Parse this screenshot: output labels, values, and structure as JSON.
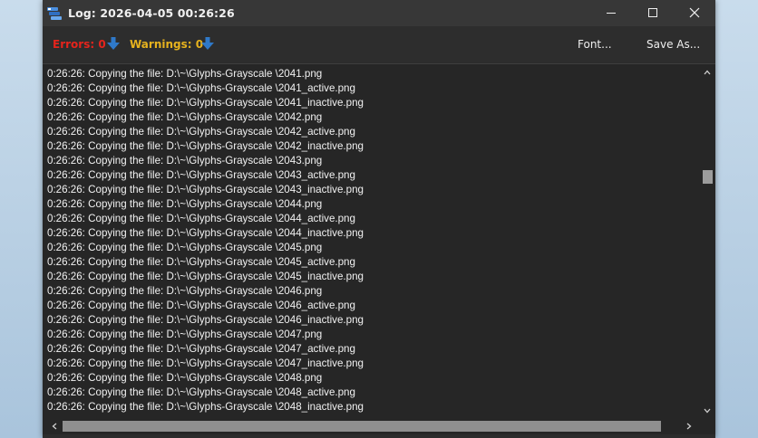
{
  "window": {
    "title": "Log: 2026-04-05 00:26:26",
    "icon": "log-app-icon",
    "controls": [
      "minimize-icon",
      "maximize-icon",
      "close-icon"
    ]
  },
  "toolbar": {
    "errors_label": "Errors: 0",
    "warnings_label": "Warnings: 0",
    "font_label": "Font...",
    "save_as_label": "Save As...",
    "arrow_icon": "arrow-down-icon",
    "colors": {
      "errors": "#e5241c",
      "warnings": "#e6b21e",
      "arrow": "#2f79c9"
    }
  },
  "log": {
    "lines": [
      "0:26:26: Copying the file: D:\\~\\Glyphs-Grayscale \\2041.png",
      "0:26:26: Copying the file: D:\\~\\Glyphs-Grayscale \\2041_active.png",
      "0:26:26: Copying the file: D:\\~\\Glyphs-Grayscale \\2041_inactive.png",
      "0:26:26: Copying the file: D:\\~\\Glyphs-Grayscale \\2042.png",
      "0:26:26: Copying the file: D:\\~\\Glyphs-Grayscale \\2042_active.png",
      "0:26:26: Copying the file: D:\\~\\Glyphs-Grayscale \\2042_inactive.png",
      "0:26:26: Copying the file: D:\\~\\Glyphs-Grayscale \\2043.png",
      "0:26:26: Copying the file: D:\\~\\Glyphs-Grayscale \\2043_active.png",
      "0:26:26: Copying the file: D:\\~\\Glyphs-Grayscale \\2043_inactive.png",
      "0:26:26: Copying the file: D:\\~\\Glyphs-Grayscale \\2044.png",
      "0:26:26: Copying the file: D:\\~\\Glyphs-Grayscale \\2044_active.png",
      "0:26:26: Copying the file: D:\\~\\Glyphs-Grayscale \\2044_inactive.png",
      "0:26:26: Copying the file: D:\\~\\Glyphs-Grayscale \\2045.png",
      "0:26:26: Copying the file: D:\\~\\Glyphs-Grayscale \\2045_active.png",
      "0:26:26: Copying the file: D:\\~\\Glyphs-Grayscale \\2045_inactive.png",
      "0:26:26: Copying the file: D:\\~\\Glyphs-Grayscale \\2046.png",
      "0:26:26: Copying the file: D:\\~\\Glyphs-Grayscale \\2046_active.png",
      "0:26:26: Copying the file: D:\\~\\Glyphs-Grayscale \\2046_inactive.png",
      "0:26:26: Copying the file: D:\\~\\Glyphs-Grayscale \\2047.png",
      "0:26:26: Copying the file: D:\\~\\Glyphs-Grayscale \\2047_active.png",
      "0:26:26: Copying the file: D:\\~\\Glyphs-Grayscale \\2047_inactive.png",
      "0:26:26: Copying the file: D:\\~\\Glyphs-Grayscale \\2048.png",
      "0:26:26: Copying the file: D:\\~\\Glyphs-Grayscale \\2048_active.png",
      "0:26:26: Copying the file: D:\\~\\Glyphs-Grayscale \\2048_inactive.png"
    ],
    "text_color": "#f2f2f2",
    "background": "#262626"
  },
  "scrollbars": {
    "vertical_icons": [
      "chevron-up-icon",
      "chevron-down-icon"
    ],
    "horizontal_icons": [
      "chevron-left-icon",
      "chevron-right-icon"
    ]
  }
}
